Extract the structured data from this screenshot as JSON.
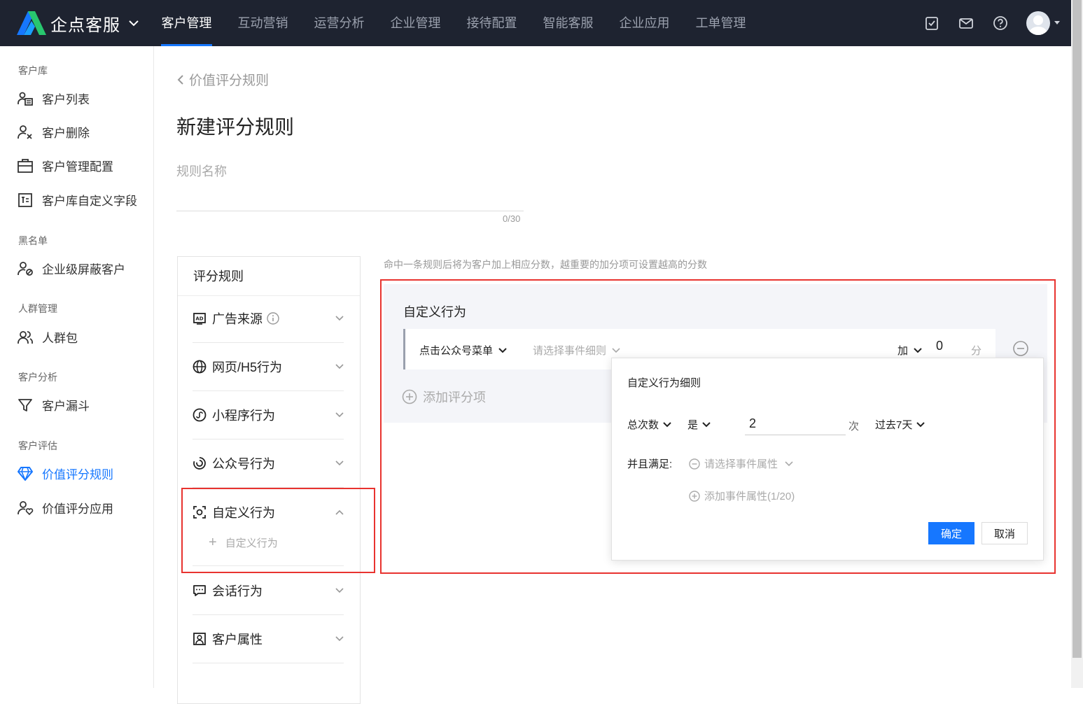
{
  "app": {
    "name": "企点客服"
  },
  "nav": {
    "items": [
      "客户管理",
      "互动营销",
      "运营分析",
      "企业管理",
      "接待配置",
      "智能客服",
      "企业应用",
      "工单管理"
    ]
  },
  "sidebar": {
    "groups": [
      "客户库",
      "黑名单",
      "人群管理",
      "客户分析",
      "客户评估"
    ],
    "items": [
      "客户列表",
      "客户删除",
      "客户管理配置",
      "客户库自定义字段",
      "企业级屏蔽客户",
      "人群包",
      "客户漏斗",
      "价值评分规则",
      "价值评分应用"
    ]
  },
  "breadcrumb": {
    "back": "价值评分规则"
  },
  "page": {
    "title": "新建评分规则"
  },
  "form": {
    "name_placeholder": "规则名称",
    "name_value": "",
    "counter": "0/30"
  },
  "rules": {
    "header": "评分规则",
    "items": [
      "广告来源",
      "网页/H5行为",
      "小程序行为",
      "公众号行为",
      "自定义行为",
      "会话行为",
      "客户属性"
    ],
    "sub_item": "自定义行为"
  },
  "main": {
    "hint": "命中一条规则后将为客户加上相应分数，越重要的加分项可设置越高的分数",
    "card_title": "自定义行为",
    "event": "点击公众号菜单",
    "detail_placeholder": "请选择事件细则",
    "op": "加",
    "score": "0",
    "unit": "分",
    "add_item": "添加评分项"
  },
  "popover": {
    "title": "自定义行为细则",
    "metric": "总次数",
    "cond": "是",
    "count": "2",
    "count_unit": "次",
    "period": "过去7天",
    "and_label": "并且满足:",
    "attr_placeholder": "请选择事件属性",
    "add_attr": "添加事件属性(1/20)",
    "ok": "确定",
    "cancel": "取消"
  },
  "colors": {
    "accent": "#1677ff",
    "topbar": "#1e2330",
    "highlight": "#e8332f"
  }
}
